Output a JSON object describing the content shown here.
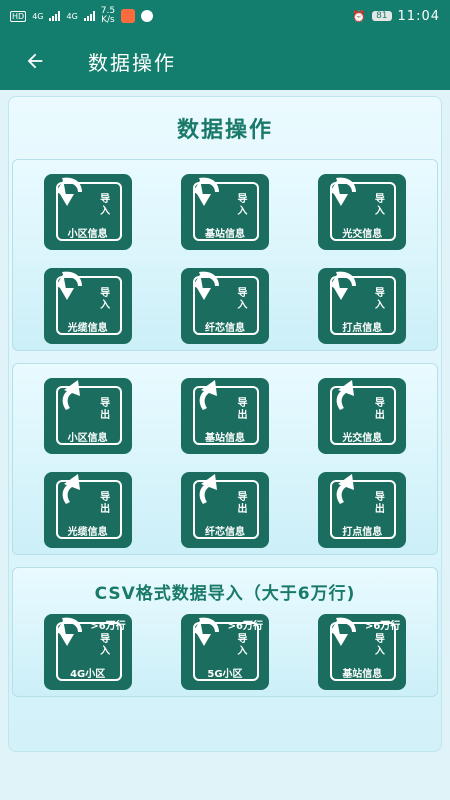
{
  "status": {
    "net_speed": "7.5\nK/s",
    "net_speed_top": "7.5",
    "net_speed_bottom": "K/s",
    "hd1": "HD",
    "hd2": "HD",
    "lte1": "4G",
    "lte2": "4G",
    "battery": "81",
    "time": "11:04"
  },
  "appbar": {
    "title": "数据操作",
    "back_icon": "arrow-left-icon"
  },
  "panel": {
    "title": "数据操作"
  },
  "import_group": [
    {
      "v": "导入",
      "label": "小区信息"
    },
    {
      "v": "导入",
      "label": "基站信息"
    },
    {
      "v": "导入",
      "label": "光交信息"
    },
    {
      "v": "导入",
      "label": "光缆信息"
    },
    {
      "v": "导入",
      "label": "纤芯信息"
    },
    {
      "v": "导入",
      "label": "打点信息"
    }
  ],
  "export_group": [
    {
      "v": "导出",
      "label": "小区信息"
    },
    {
      "v": "导出",
      "label": "基站信息"
    },
    {
      "v": "导出",
      "label": "光交信息"
    },
    {
      "v": "导出",
      "label": "光缆信息"
    },
    {
      "v": "导出",
      "label": "纤芯信息"
    },
    {
      "v": "导出",
      "label": "打点信息"
    }
  ],
  "csv": {
    "title": "CSV格式数据导入（大于6万行)",
    "items": [
      {
        "cap": ">6万行",
        "v": "导入",
        "label": "4G小区"
      },
      {
        "cap": ">6万行",
        "v": "导入",
        "label": "5G小区"
      },
      {
        "cap": ">6万行",
        "v": "导入",
        "label": "基站信息"
      }
    ]
  },
  "colors": {
    "primary": "#137e6e",
    "tile": "#1b6e5f",
    "panel_bg": "#d2f1f9"
  }
}
